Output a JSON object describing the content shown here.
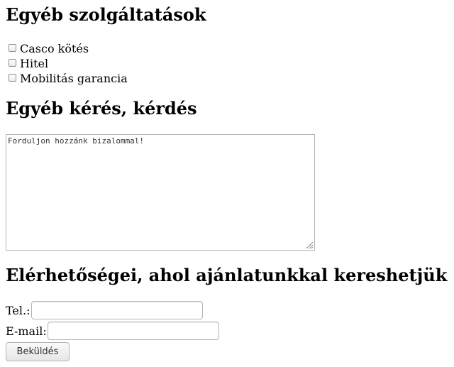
{
  "services": {
    "heading": "Egyéb szolgáltatások",
    "options": [
      {
        "label": "Casco kötés",
        "checked": false
      },
      {
        "label": "Hitel",
        "checked": false
      },
      {
        "label": "Mobilitás garancia",
        "checked": false
      }
    ]
  },
  "request": {
    "heading": "Egyéb kérés, kérdés",
    "textarea_value": "Forduljon hozzánk bizalommal!"
  },
  "contact": {
    "heading": "Elérhetőségei, ahol ajánlatunkkal kereshetjük",
    "tel_label": "Tel.:",
    "tel_value": "",
    "email_label": "E-mail:",
    "email_value": "",
    "submit_label": "Beküldés"
  }
}
